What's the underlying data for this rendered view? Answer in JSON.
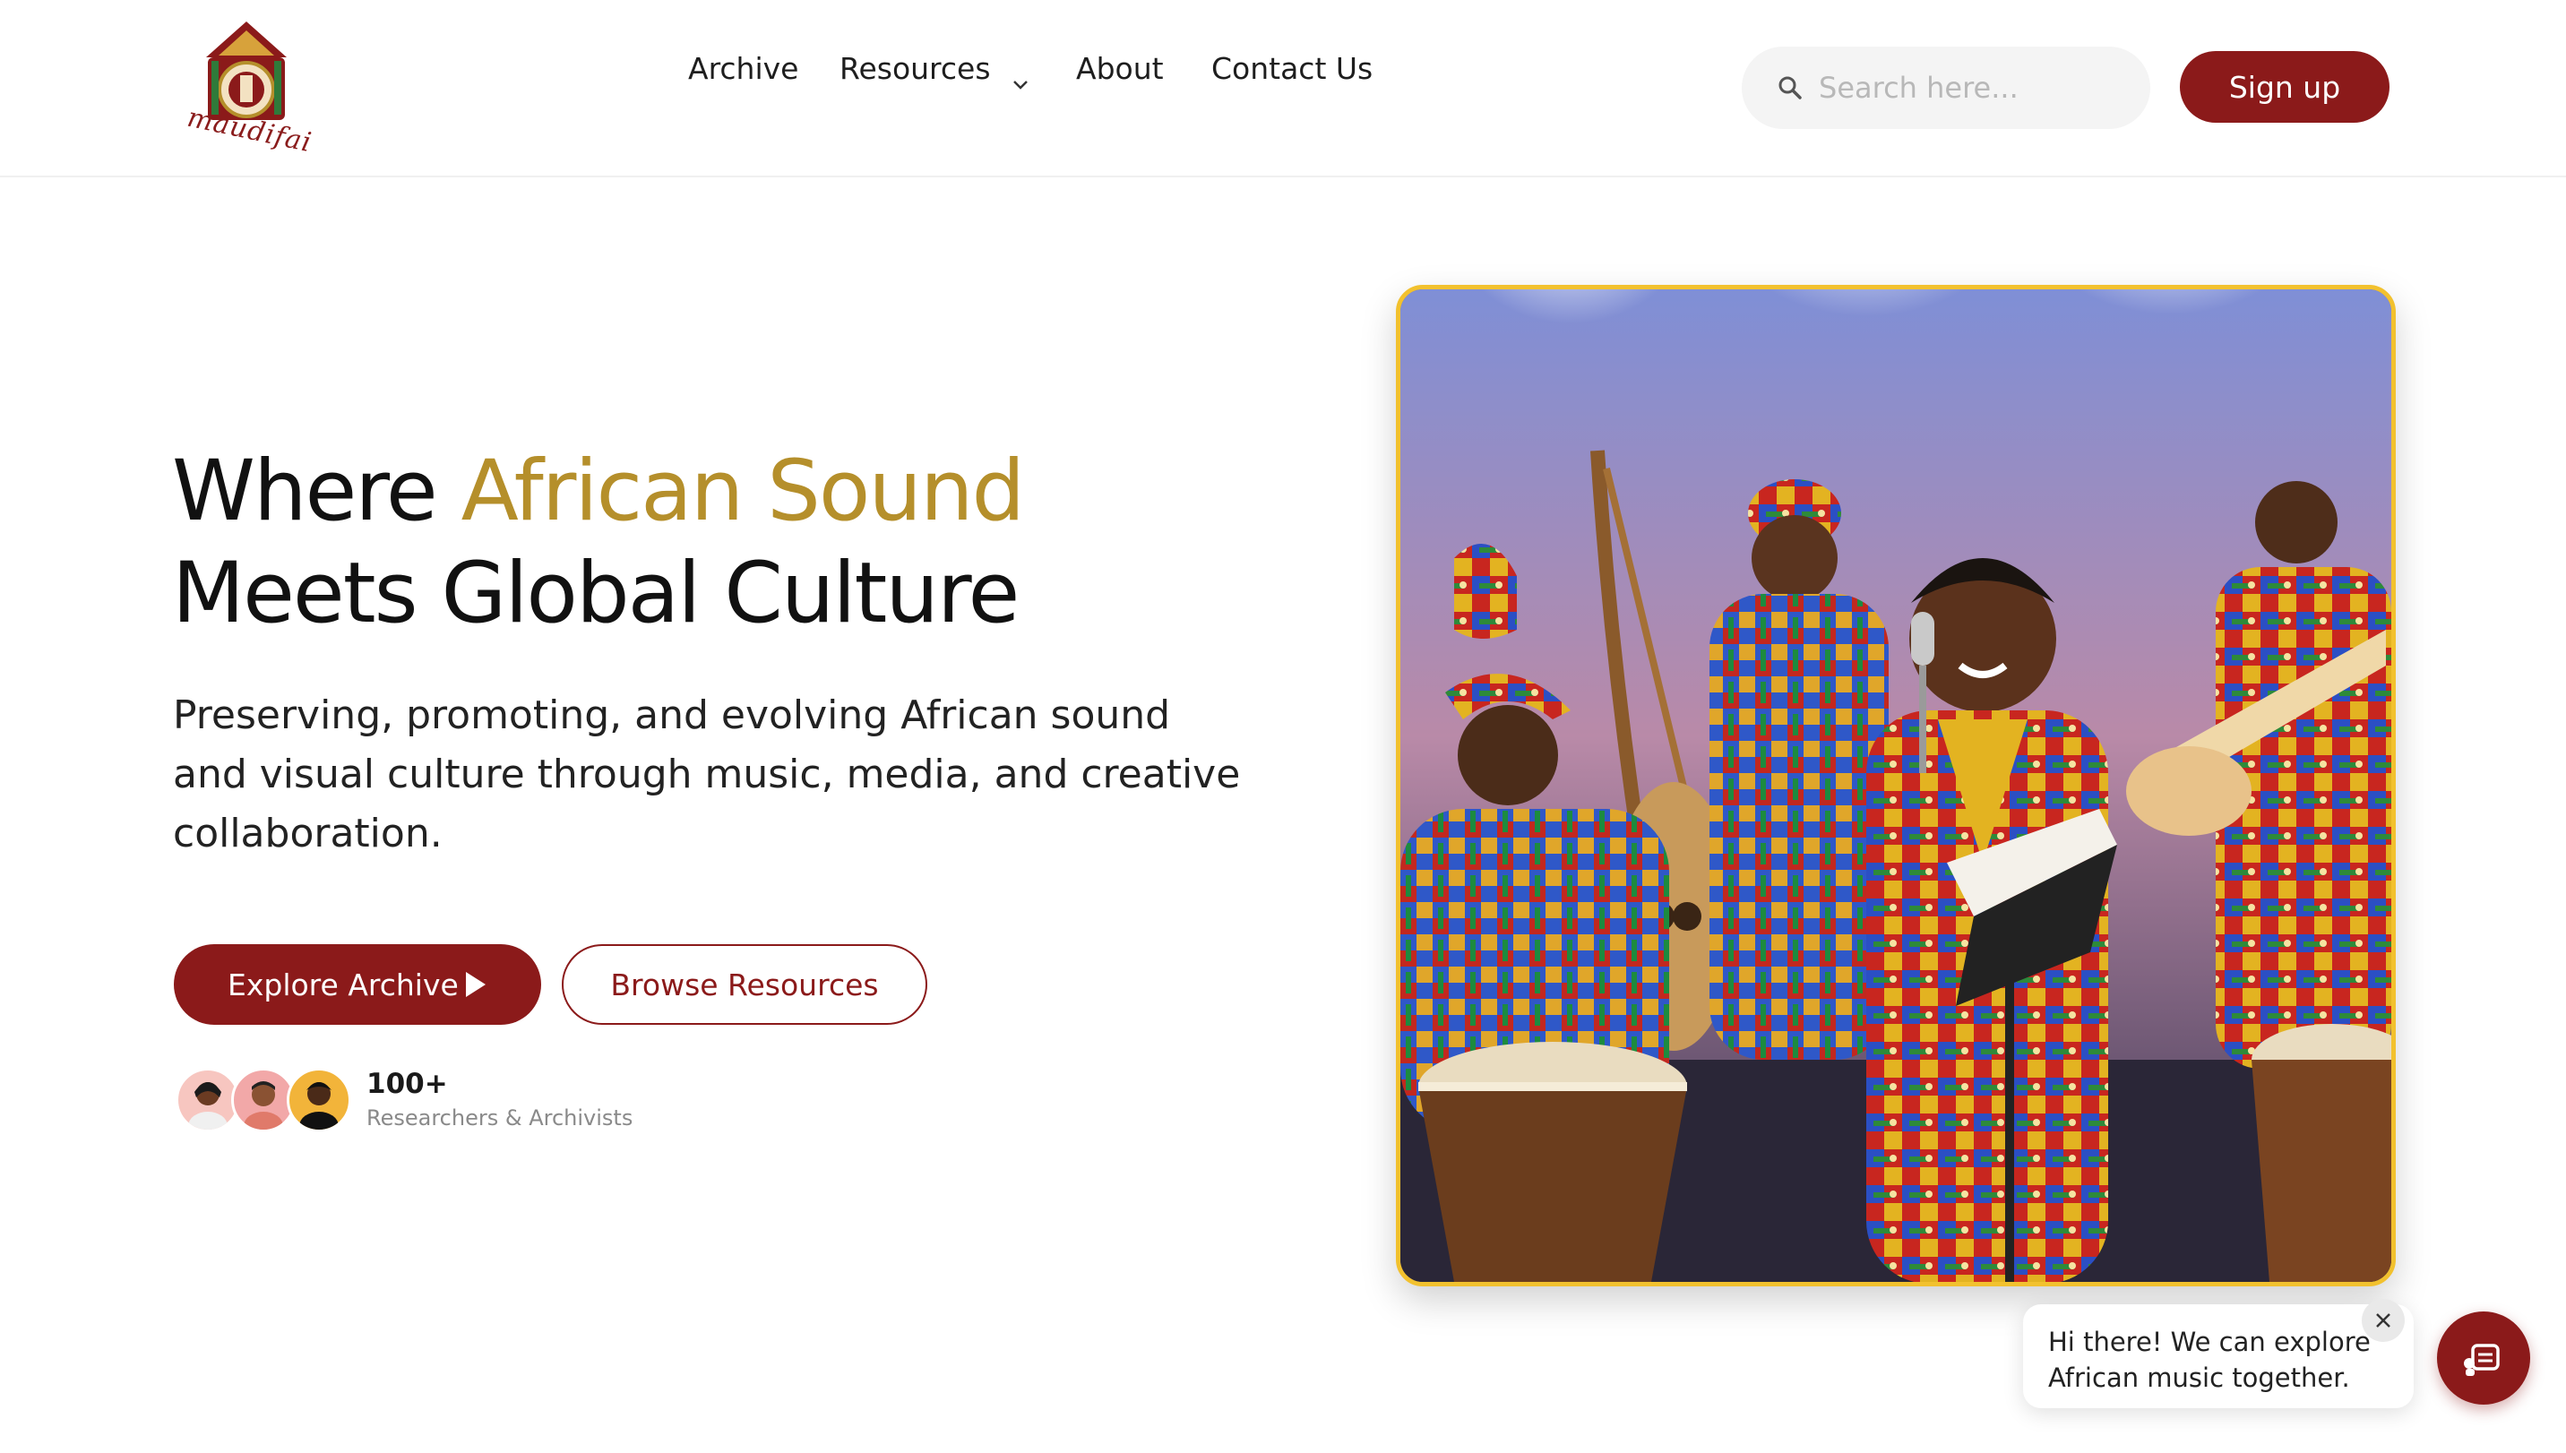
{
  "brand": {
    "name": "maudifai",
    "logo_icon": "drum-house-logo",
    "color": "#8b1a1a"
  },
  "nav": {
    "archive": "Archive",
    "resources": "Resources",
    "about": "About",
    "contact": "Contact Us"
  },
  "search": {
    "placeholder": "Search here...",
    "value": ""
  },
  "signup_label": "Sign up",
  "hero": {
    "title_prefix": "Where ",
    "title_accent": "African Sound",
    "title_line2": "Meets Global Culture",
    "description": "Preserving, promoting, and evolving African sound and visual culture through music, media, and creative collaboration.",
    "primary_cta": "Explore Archive",
    "secondary_cta": "Browse Resources",
    "community_count": "100+",
    "community_label": "Researchers & Archivists",
    "accent_color": "#b58f2b",
    "image_icon": "african-band-performance-photo"
  },
  "chat": {
    "message": "Hi there! We can explore African music together.",
    "close_icon": "close-icon",
    "fab_icon": "chat-bot-icon"
  }
}
